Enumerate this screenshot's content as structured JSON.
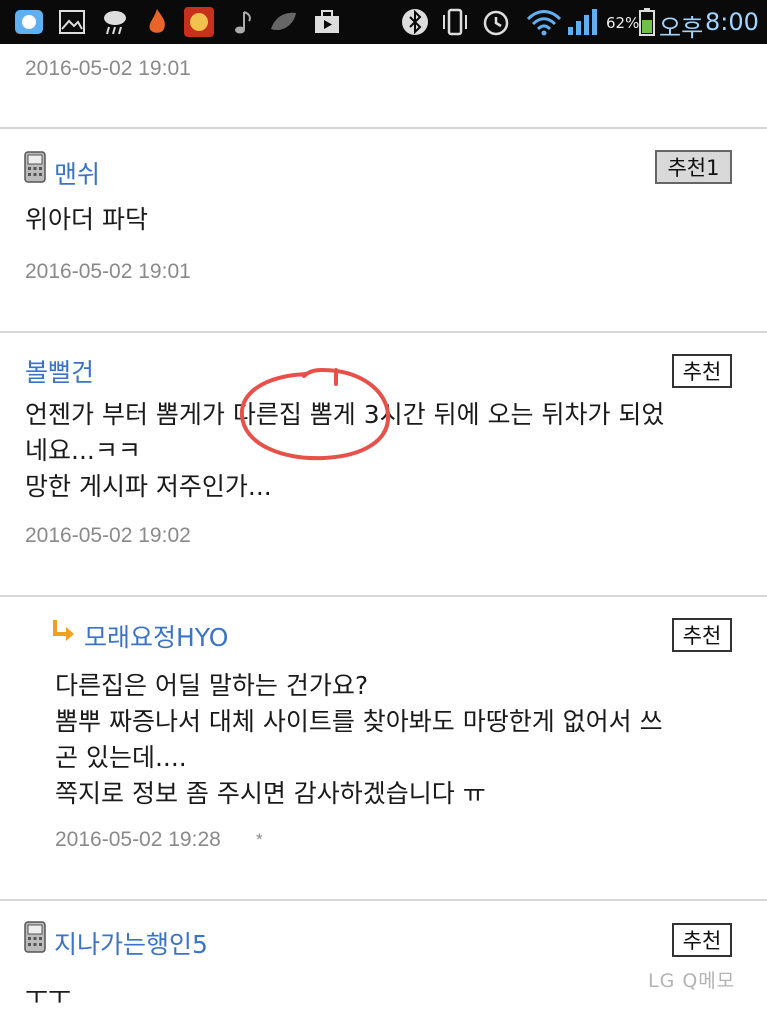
{
  "status_bar": {
    "battery_pct": "62%",
    "ampm": "오후",
    "time": "8:00",
    "icons": [
      "chat-icon",
      "gallery-icon",
      "weather-icon",
      "flame-icon",
      "game-app-icon",
      "music-icon",
      "leaf-icon",
      "briefcase-icon",
      "bluetooth-icon",
      "vibrate-icon",
      "alarm-icon",
      "wifi-icon",
      "signal-icon",
      "battery-icon"
    ]
  },
  "comments": [
    {
      "date": "2016-05-02 19:01"
    },
    {
      "author": "맨쉬",
      "recommend_label": "추천1",
      "body": "위아더 파닥",
      "date": "2016-05-02 19:01"
    },
    {
      "author": "볼뻘건",
      "recommend_label": "추천",
      "body": "언젠가 부터 뽐게가 다른집 뽐게 3시간 뒤에 오는 뒤차가 되었\n네요...ㅋㅋ\n망한 게시파 저주인가...",
      "date": "2016-05-02 19:02"
    },
    {
      "author": "모래요정HYO",
      "recommend_label": "추천",
      "body": "다른집은 어딜 말하는 건가요?\n뽐뿌 짜증나서 대체 사이트를 찾아봐도 마땅한게 없어서 쓰\n곤 있는데....\n쪽지로 정보 좀 주시면 감사하겠습니다 ㅠ",
      "date": "2016-05-02 19:28",
      "date_suffix": "*"
    },
    {
      "author": "지나가는행인5",
      "recommend_label": "추천",
      "body": "ㅜㅜ"
    }
  ],
  "watermark": "LG Q메모",
  "colors": {
    "author": "#3a73c8",
    "annotation": "#e8504a",
    "status_bar_bg": "#0a0a0a"
  }
}
